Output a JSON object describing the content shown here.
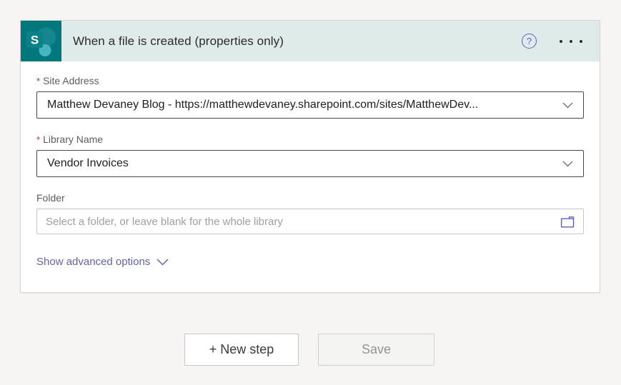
{
  "header": {
    "title": "When a file is created (properties only)",
    "logo_letter": "S",
    "help_glyph": "?",
    "icon_name": "sharepoint-icon",
    "colors": {
      "header_bg": "#dfebe9",
      "icon_bg": "#03787c",
      "icon_circle_large": "#17858e",
      "icon_circle_small": "#45b5c1"
    }
  },
  "fields": {
    "site_address": {
      "label": "Site Address",
      "required_marker": "*",
      "value": "Matthew Devaney Blog - https://matthewdevaney.sharepoint.com/sites/MatthewDev..."
    },
    "library_name": {
      "label": "Library Name",
      "required_marker": "*",
      "value": "Vendor Invoices"
    },
    "folder": {
      "label": "Folder",
      "placeholder": "Select a folder, or leave blank for the whole library"
    }
  },
  "advanced": {
    "label": "Show advanced options"
  },
  "actions": {
    "new_step": "+ New step",
    "save": "Save"
  },
  "icons": {
    "help": "question-mark-circle",
    "more": "ellipsis-dots",
    "chevron": "chevron-down",
    "folder": "folder-outline"
  },
  "colors": {
    "accent": "#6264a7",
    "required": "#bc2f32",
    "page_bg": "#f6f5f3"
  }
}
